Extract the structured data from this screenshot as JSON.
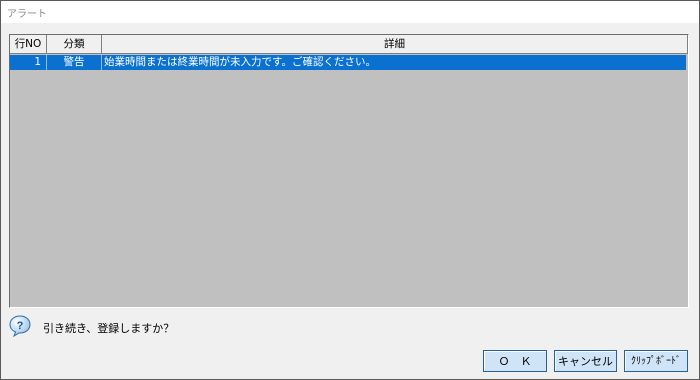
{
  "window": {
    "title": "アラート"
  },
  "grid": {
    "columns": [
      "行NO",
      "分類",
      "詳細"
    ],
    "rows": [
      {
        "no": "1",
        "category": "警告",
        "detail": "始業時間または終業時間が未入力です。ご確認ください。"
      }
    ]
  },
  "message": {
    "text": "引き続き、登録しますか？",
    "icon": "question-icon"
  },
  "buttons": {
    "ok": "Ｏ　Ｋ",
    "cancel": "キャンセル",
    "clipboard": "ｸﾘｯﾌﾟﾎﾞｰﾄﾞ"
  },
  "colors": {
    "selection": "#0a71d0",
    "grid_bg": "#c0c0c0",
    "button_bg": "#cfe4f7"
  }
}
